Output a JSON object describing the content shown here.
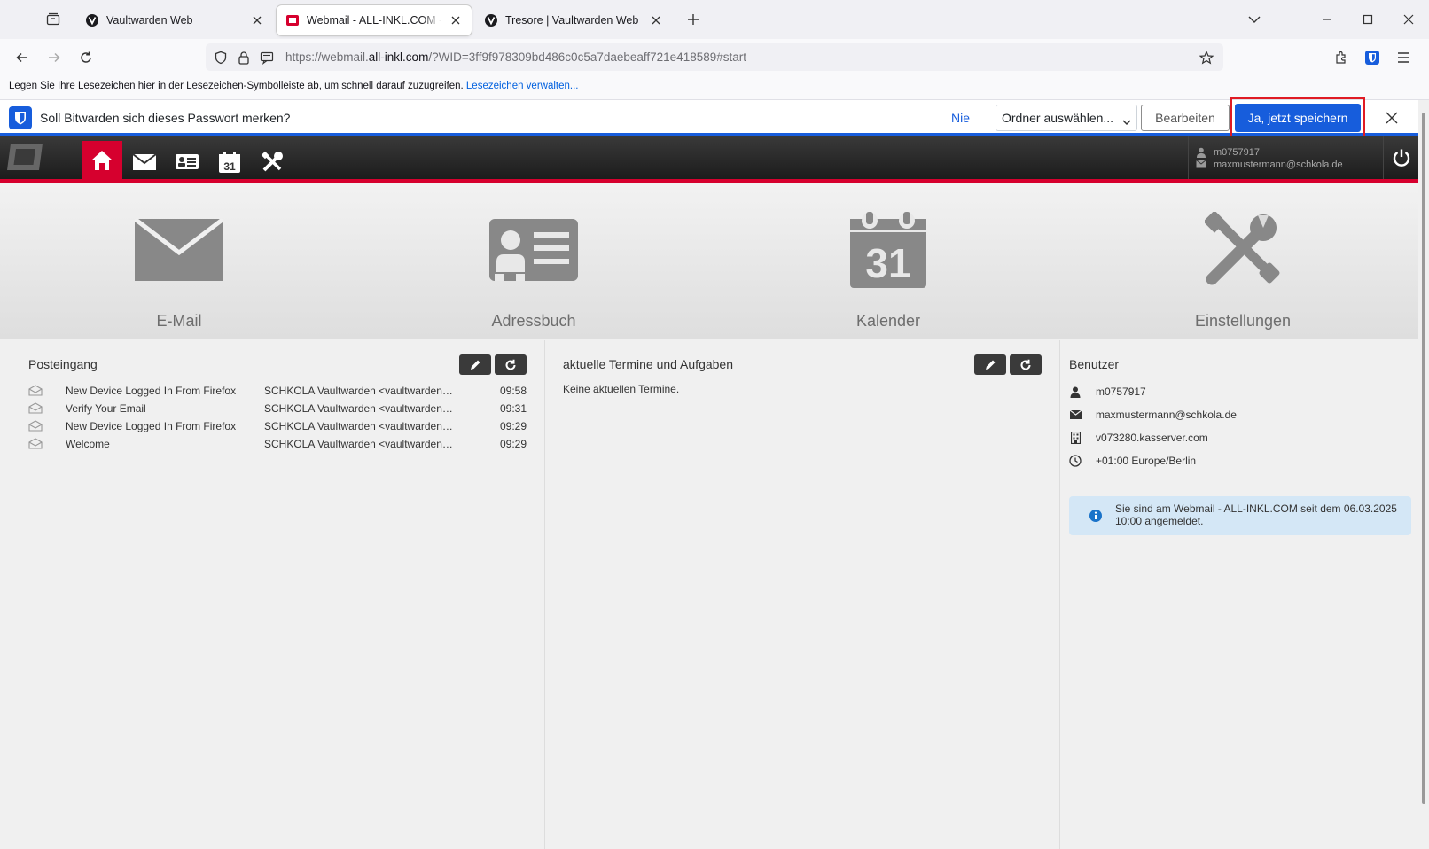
{
  "browser": {
    "tabs": [
      {
        "title": "Vaultwarden Web",
        "active": false
      },
      {
        "title": "Webmail - ALL-INKL.COM - ma",
        "active": true
      },
      {
        "title": "Tresore | Vaultwarden Web",
        "active": false
      }
    ],
    "url": {
      "prefix": "https://webmail.",
      "domain": "all-inkl.com",
      "rest": "/?WID=3ff9f978309bd486c0c5a7daebeaff721e418589#start"
    },
    "bookmark_bar": {
      "text": "Legen Sie Ihre Lesezeichen hier in der Lesezeichen-Symbolleiste ab, um schnell darauf zuzugreifen.",
      "link": "Lesezeichen verwalten..."
    }
  },
  "bitwarden": {
    "question": "Soll Bitwarden sich dieses Passwort merken?",
    "never": "Nie",
    "folder_select": "Ordner auswählen...",
    "edit": "Bearbeiten",
    "save": "Ja, jetzt speichern",
    "accent": "#175ddc"
  },
  "webmail": {
    "accent": "#d6002e",
    "user": {
      "login": "m0757917",
      "email": "maxmustermann@schkola.de"
    },
    "launcher": [
      {
        "label": "E-Mail",
        "icon": "envelope-icon"
      },
      {
        "label": "Adressbuch",
        "icon": "address-card-icon"
      },
      {
        "label": "Kalender",
        "icon": "calendar-icon"
      },
      {
        "label": "Einstellungen",
        "icon": "tools-icon"
      }
    ],
    "inbox": {
      "title": "Posteingang",
      "rows": [
        {
          "subject": "New Device Logged In From Firefox",
          "from": "SCHKOLA Vaultwarden <vaultwarden@schkola.de>",
          "time": "09:58"
        },
        {
          "subject": "Verify Your Email",
          "from": "SCHKOLA Vaultwarden <vaultwarden@schkola.de>",
          "time": "09:31"
        },
        {
          "subject": "New Device Logged In From Firefox",
          "from": "SCHKOLA Vaultwarden <vaultwarden@schkola.de>",
          "time": "09:29"
        },
        {
          "subject": "Welcome",
          "from": "SCHKOLA Vaultwarden <vaultwarden@schkola.de>",
          "time": "09:29"
        }
      ]
    },
    "events": {
      "title": "aktuelle Termine und Aufgaben",
      "empty": "Keine aktuellen Termine."
    },
    "userinfo": {
      "title": "Benutzer",
      "login": "m0757917",
      "email": "maxmustermann@schkola.de",
      "server": "v073280.kasserver.com",
      "timezone": "+01:00 Europe/Berlin",
      "notice": "Sie sind am Webmail - ALL-INKL.COM seit dem 06.03.2025 10:00 angemeldet."
    }
  }
}
